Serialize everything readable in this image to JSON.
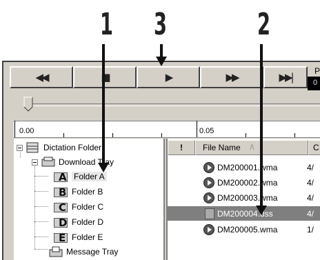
{
  "callouts": {
    "n1": "1",
    "n2": "2",
    "n3": "3"
  },
  "toolbar": {
    "rewind_icon": "rewind-icon",
    "stop_icon": "stop-icon",
    "play_icon": "play-icon",
    "ff_icon": "fast-forward-icon",
    "next_icon": "skip-next-icon",
    "pos_label": "P",
    "pos_value": "0"
  },
  "timeline": {
    "start": "0.00",
    "mid": "0.05"
  },
  "tree": {
    "root": "Dictation Folder",
    "download_tray": "Download Tray",
    "folders": [
      "Folder A",
      "Folder B",
      "Folder C",
      "Folder D",
      "Folder E"
    ],
    "folder_letters": [
      "A",
      "B",
      "C",
      "D",
      "E"
    ],
    "message_tray": "Message Tray"
  },
  "list": {
    "col_flag": "!",
    "col_name": "File Name",
    "col_sort": "/\\",
    "col_date": "C",
    "rows": [
      {
        "name": "DM200001.wma",
        "date": "4/"
      },
      {
        "name": "DM200002.wma",
        "date": "4/"
      },
      {
        "name": "DM200003.wma",
        "date": "4/"
      },
      {
        "name": "DM200004.dss",
        "date": "4/"
      },
      {
        "name": "DM200005.wma",
        "date": "1/"
      }
    ]
  }
}
